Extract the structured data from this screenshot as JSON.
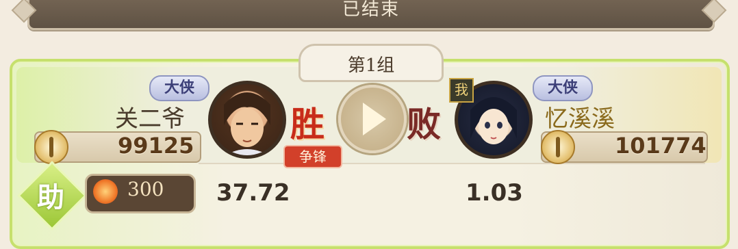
{
  "banner": {
    "title": "已结束"
  },
  "group": {
    "label": "第1组"
  },
  "left_player": {
    "rank": "大侠",
    "name": "关二爷",
    "power": "99125",
    "odds": "37.72",
    "result": "胜"
  },
  "right_player": {
    "rank": "大侠",
    "name": "忆溪溪",
    "power": "101774",
    "odds": "1.03",
    "result": "败",
    "me_badge": "我"
  },
  "tag": "争锋",
  "assist": {
    "label": "助",
    "bet": "300"
  },
  "colors": {
    "accent_green": "#c6e06d",
    "win_red": "#c82c1a",
    "banner_brown": "#6b5c4c"
  }
}
